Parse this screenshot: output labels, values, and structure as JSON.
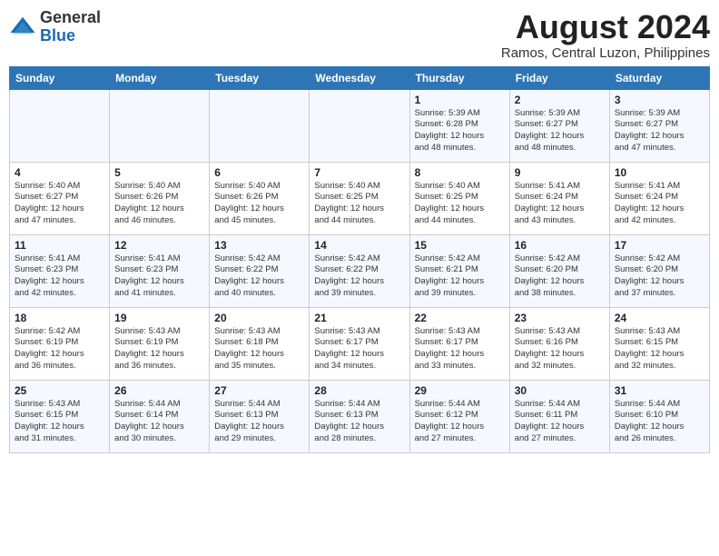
{
  "header": {
    "logo_general": "General",
    "logo_blue": "Blue",
    "month_year": "August 2024",
    "location": "Ramos, Central Luzon, Philippines"
  },
  "days_of_week": [
    "Sunday",
    "Monday",
    "Tuesday",
    "Wednesday",
    "Thursday",
    "Friday",
    "Saturday"
  ],
  "weeks": [
    [
      {
        "day": "",
        "info": ""
      },
      {
        "day": "",
        "info": ""
      },
      {
        "day": "",
        "info": ""
      },
      {
        "day": "",
        "info": ""
      },
      {
        "day": "1",
        "info": "Sunrise: 5:39 AM\nSunset: 6:28 PM\nDaylight: 12 hours\nand 48 minutes."
      },
      {
        "day": "2",
        "info": "Sunrise: 5:39 AM\nSunset: 6:27 PM\nDaylight: 12 hours\nand 48 minutes."
      },
      {
        "day": "3",
        "info": "Sunrise: 5:39 AM\nSunset: 6:27 PM\nDaylight: 12 hours\nand 47 minutes."
      }
    ],
    [
      {
        "day": "4",
        "info": "Sunrise: 5:40 AM\nSunset: 6:27 PM\nDaylight: 12 hours\nand 47 minutes."
      },
      {
        "day": "5",
        "info": "Sunrise: 5:40 AM\nSunset: 6:26 PM\nDaylight: 12 hours\nand 46 minutes."
      },
      {
        "day": "6",
        "info": "Sunrise: 5:40 AM\nSunset: 6:26 PM\nDaylight: 12 hours\nand 45 minutes."
      },
      {
        "day": "7",
        "info": "Sunrise: 5:40 AM\nSunset: 6:25 PM\nDaylight: 12 hours\nand 44 minutes."
      },
      {
        "day": "8",
        "info": "Sunrise: 5:40 AM\nSunset: 6:25 PM\nDaylight: 12 hours\nand 44 minutes."
      },
      {
        "day": "9",
        "info": "Sunrise: 5:41 AM\nSunset: 6:24 PM\nDaylight: 12 hours\nand 43 minutes."
      },
      {
        "day": "10",
        "info": "Sunrise: 5:41 AM\nSunset: 6:24 PM\nDaylight: 12 hours\nand 42 minutes."
      }
    ],
    [
      {
        "day": "11",
        "info": "Sunrise: 5:41 AM\nSunset: 6:23 PM\nDaylight: 12 hours\nand 42 minutes."
      },
      {
        "day": "12",
        "info": "Sunrise: 5:41 AM\nSunset: 6:23 PM\nDaylight: 12 hours\nand 41 minutes."
      },
      {
        "day": "13",
        "info": "Sunrise: 5:42 AM\nSunset: 6:22 PM\nDaylight: 12 hours\nand 40 minutes."
      },
      {
        "day": "14",
        "info": "Sunrise: 5:42 AM\nSunset: 6:22 PM\nDaylight: 12 hours\nand 39 minutes."
      },
      {
        "day": "15",
        "info": "Sunrise: 5:42 AM\nSunset: 6:21 PM\nDaylight: 12 hours\nand 39 minutes."
      },
      {
        "day": "16",
        "info": "Sunrise: 5:42 AM\nSunset: 6:20 PM\nDaylight: 12 hours\nand 38 minutes."
      },
      {
        "day": "17",
        "info": "Sunrise: 5:42 AM\nSunset: 6:20 PM\nDaylight: 12 hours\nand 37 minutes."
      }
    ],
    [
      {
        "day": "18",
        "info": "Sunrise: 5:42 AM\nSunset: 6:19 PM\nDaylight: 12 hours\nand 36 minutes."
      },
      {
        "day": "19",
        "info": "Sunrise: 5:43 AM\nSunset: 6:19 PM\nDaylight: 12 hours\nand 36 minutes."
      },
      {
        "day": "20",
        "info": "Sunrise: 5:43 AM\nSunset: 6:18 PM\nDaylight: 12 hours\nand 35 minutes."
      },
      {
        "day": "21",
        "info": "Sunrise: 5:43 AM\nSunset: 6:17 PM\nDaylight: 12 hours\nand 34 minutes."
      },
      {
        "day": "22",
        "info": "Sunrise: 5:43 AM\nSunset: 6:17 PM\nDaylight: 12 hours\nand 33 minutes."
      },
      {
        "day": "23",
        "info": "Sunrise: 5:43 AM\nSunset: 6:16 PM\nDaylight: 12 hours\nand 32 minutes."
      },
      {
        "day": "24",
        "info": "Sunrise: 5:43 AM\nSunset: 6:15 PM\nDaylight: 12 hours\nand 32 minutes."
      }
    ],
    [
      {
        "day": "25",
        "info": "Sunrise: 5:43 AM\nSunset: 6:15 PM\nDaylight: 12 hours\nand 31 minutes."
      },
      {
        "day": "26",
        "info": "Sunrise: 5:44 AM\nSunset: 6:14 PM\nDaylight: 12 hours\nand 30 minutes."
      },
      {
        "day": "27",
        "info": "Sunrise: 5:44 AM\nSunset: 6:13 PM\nDaylight: 12 hours\nand 29 minutes."
      },
      {
        "day": "28",
        "info": "Sunrise: 5:44 AM\nSunset: 6:13 PM\nDaylight: 12 hours\nand 28 minutes."
      },
      {
        "day": "29",
        "info": "Sunrise: 5:44 AM\nSunset: 6:12 PM\nDaylight: 12 hours\nand 27 minutes."
      },
      {
        "day": "30",
        "info": "Sunrise: 5:44 AM\nSunset: 6:11 PM\nDaylight: 12 hours\nand 27 minutes."
      },
      {
        "day": "31",
        "info": "Sunrise: 5:44 AM\nSunset: 6:10 PM\nDaylight: 12 hours\nand 26 minutes."
      }
    ]
  ]
}
